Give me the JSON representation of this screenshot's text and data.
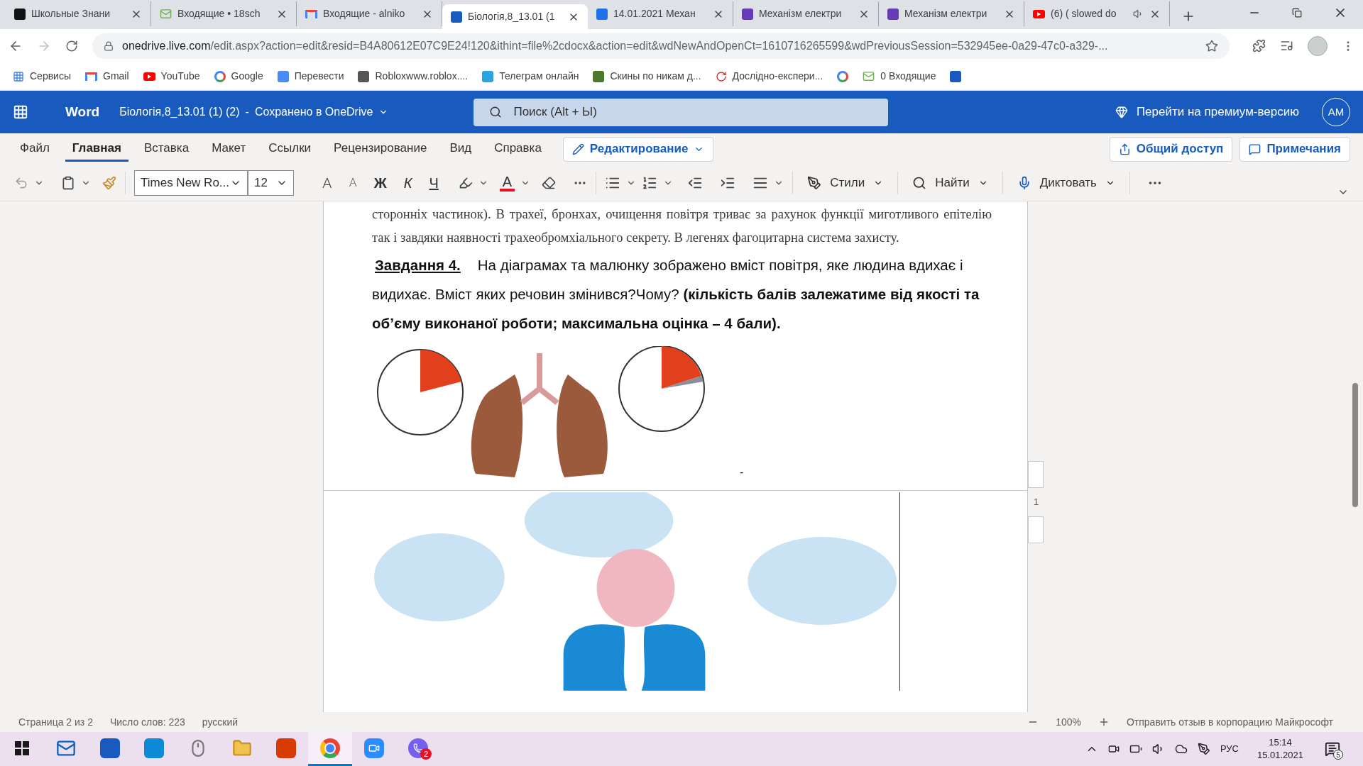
{
  "browser": {
    "tabs": [
      {
        "title": "Школьные Знани",
        "kind": "znanija",
        "selected": false,
        "audio": false
      },
      {
        "title": "Входящие • 18sch",
        "kind": "mail",
        "selected": false,
        "audio": false
      },
      {
        "title": "Входящие - alniko",
        "kind": "gmail",
        "selected": false,
        "audio": false
      },
      {
        "title": "Біологія,8_13.01 (1",
        "kind": "word",
        "selected": true,
        "audio": false
      },
      {
        "title": "14.01.2021 Механ",
        "kind": "classroom",
        "selected": false,
        "audio": false
      },
      {
        "title": "Механізм електри",
        "kind": "forms",
        "selected": false,
        "audio": false
      },
      {
        "title": "Механізм електри",
        "kind": "forms",
        "selected": false,
        "audio": false
      },
      {
        "title": "(6) ( slowed do",
        "kind": "youtube",
        "selected": false,
        "audio": true
      }
    ],
    "url_domain": "onedrive.live.com",
    "url_rest": "/edit.aspx?action=edit&resid=B4A80612E07C9E24!120&ithint=file%2cdocx&action=edit&wdNewAndOpenCt=1610716265599&wdPreviousSession=532945ee-0a29-47c0-a329-...",
    "bookmarks": [
      {
        "label": "Сервисы",
        "kind": "apps"
      },
      {
        "label": "Gmail",
        "kind": "gmail"
      },
      {
        "label": "YouTube",
        "kind": "youtube"
      },
      {
        "label": "Google",
        "kind": "google"
      },
      {
        "label": "Перевести",
        "kind": "translate"
      },
      {
        "label": "Robloxwww.roblox....",
        "kind": "roblox"
      },
      {
        "label": "Телеграм онлайн",
        "kind": "telegram"
      },
      {
        "label": "Скины по никам д...",
        "kind": "cube"
      },
      {
        "label": "Дослідно-експери...",
        "kind": "refresh"
      },
      {
        "kind": "google"
      },
      {
        "label": "0 Входящие",
        "kind": "mail"
      },
      {
        "kind": "word"
      }
    ]
  },
  "word": {
    "app": "Word",
    "doc_title": "Біологія,8_13.01 (1) (2)",
    "separator": "-",
    "save_status": "Сохранено в OneDrive",
    "search": {
      "placeholder": "Поиск (Alt + Ы)"
    },
    "premium": "Перейти на премиум-версию",
    "avatar": "АМ",
    "ribbon_tabs": [
      {
        "label": "Файл",
        "selected": false
      },
      {
        "label": "Главная",
        "selected": true
      },
      {
        "label": "Вставка",
        "selected": false
      },
      {
        "label": "Макет",
        "selected": false
      },
      {
        "label": "Ссылки",
        "selected": false
      },
      {
        "label": "Рецензирование",
        "selected": false
      },
      {
        "label": "Вид",
        "selected": false
      },
      {
        "label": "Справка",
        "selected": false
      }
    ],
    "mode": "Редактирование",
    "share": "Общий доступ",
    "comments": "Примечания",
    "font": "Times New Ro...",
    "size": "12",
    "format_glyphs": [
      {
        "kind": "grow",
        "glyph": "A"
      },
      {
        "kind": "shrink",
        "glyph": "A"
      },
      {
        "kind": "bold",
        "glyph": "Ж"
      },
      {
        "kind": "italic",
        "glyph": "К"
      },
      {
        "kind": "underline",
        "glyph": "Ч"
      }
    ],
    "font_color_glyph": "A",
    "styles": "Стили",
    "find": "Найти",
    "dictate": "Диктовать"
  },
  "document": {
    "paragraphs": [
      "сторонніх частинок). В трахеї, бронхах,  очищення повітря триває за рахунок функції миготливого епітелію так і завдяки наявності трахеобромхіального секрету. В легенях фагоцитарна система захисту."
    ],
    "task": {
      "label": "Завдання 4.",
      "text": "На діаграмах та малюнку зображено вміст повітря, яке людина вдихає і видихає. Вміст яких речовин змінився?Чому? **(кількість балів залежатиме від якості та об’єму виконаної роботи; максимальна оцінка – 4 бали).**"
    },
    "stray_mark": "-",
    "page_number": "1"
  },
  "status_bar": {
    "page": "Страница 2 из 2",
    "words": "Число слов: 223",
    "language": "русский",
    "zoom": "100%",
    "feedback": "Отправить отзыв в корпорацию Майкрософт"
  },
  "taskbar": {
    "apps": [
      {
        "kind": "windows",
        "selected": false
      },
      {
        "kind": "mail",
        "selected": false
      },
      {
        "kind": "word",
        "selected": false
      },
      {
        "kind": "edge",
        "selected": false
      },
      {
        "kind": "mouse",
        "selected": false
      },
      {
        "kind": "folder",
        "selected": false
      },
      {
        "kind": "office",
        "selected": false
      },
      {
        "kind": "chrome",
        "selected": true
      },
      {
        "kind": "zoom",
        "selected": false
      },
      {
        "kind": "viber",
        "selected": false,
        "badge": "2"
      }
    ],
    "language": "РУС",
    "time": "15:14",
    "date": "15.01.2021",
    "notifications": "5"
  }
}
